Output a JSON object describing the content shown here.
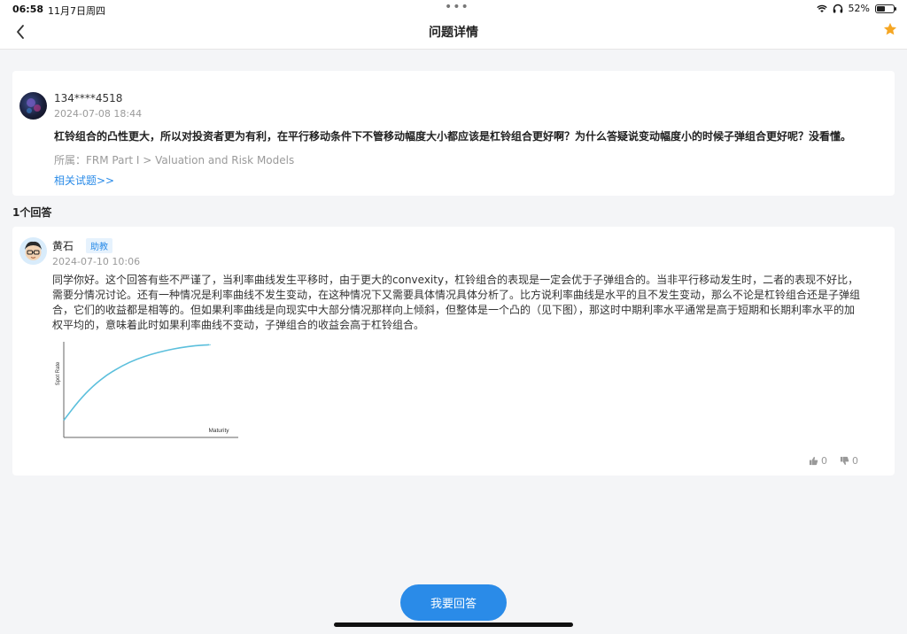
{
  "status": {
    "time": "06:58",
    "date": "11月7日周四",
    "dots": "•••",
    "battery": "52%",
    "battery_level": 0.52
  },
  "nav": {
    "title": "问题详情"
  },
  "question": {
    "user": "134****4518",
    "time": "2024-07-08 18:44",
    "text": "杠铃组合的凸性更大，所以对投资者更为有利，在平行移动条件下不管移动幅度大小都应该是杠铃组合更好啊？为什么答疑说变动幅度小的时候子弹组合更好呢？没看懂。",
    "category": "所属：FRM Part I > Valuation and Risk Models",
    "related_link": "相关试题>>"
  },
  "answers_header": "1个回答",
  "answer": {
    "user": "黄石",
    "badge": "助教",
    "time": "2024-07-10 10:06",
    "text": "同学你好。这个回答有些不严谨了，当利率曲线发生平移时，由于更大的convexity，杠铃组合的表现是一定会优于子弹组合的。当非平行移动发生时，二者的表现不好比，需要分情况讨论。还有一种情况是利率曲线不发生变动，在这种情况下又需要具体情况具体分析了。比方说利率曲线是水平的且不发生变动，那么不论是杠铃组合还是子弹组合，它们的收益都是相等的。但如果利率曲线是向现实中大部分情况那样向上倾斜，但整体是一个凸的（见下图），那这时中期利率水平通常是高于短期和长期利率水平的加权平均的，意味着此时如果利率曲线不变动，子弹组合的收益会高于杠铃组合。",
    "likes": "0",
    "dislikes": "0"
  },
  "chart_data": {
    "type": "line",
    "xlabel": "Maturity",
    "ylabel": "Spot Rate",
    "series": [
      {
        "x": [
          0,
          0.1,
          0.2,
          0.3,
          0.4,
          0.5,
          0.6,
          0.7,
          0.8,
          0.9,
          1.0
        ],
        "values": [
          0.18,
          0.38,
          0.54,
          0.66,
          0.75,
          0.82,
          0.87,
          0.91,
          0.94,
          0.96,
          0.97
        ]
      }
    ],
    "color": "#5bbfdc"
  },
  "colors": {
    "accent": "#2a8be8",
    "star": "#f5a623"
  },
  "footer": {
    "answer_button": "我要回答"
  }
}
